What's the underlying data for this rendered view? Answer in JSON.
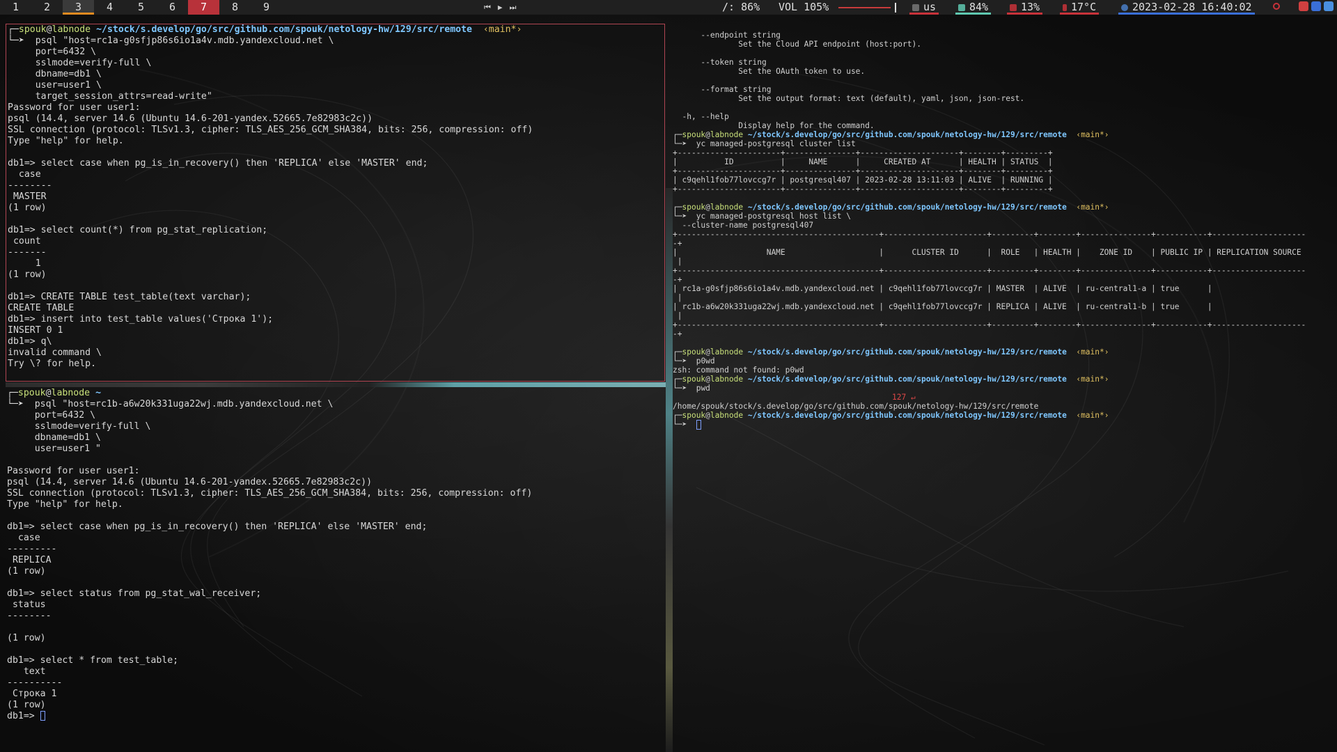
{
  "workspaces": [
    {
      "label": "1"
    },
    {
      "label": "2"
    },
    {
      "label": "3",
      "state": "focused"
    },
    {
      "label": "4"
    },
    {
      "label": "5"
    },
    {
      "label": "6"
    },
    {
      "label": "7",
      "state": "urgent"
    },
    {
      "label": "8"
    },
    {
      "label": "9"
    }
  ],
  "media": {
    "prev": "⏮",
    "play": "▶",
    "next": "⏭"
  },
  "status": {
    "disk": "/: 86%",
    "volume": "VOL 105%",
    "keyboard": "us",
    "battery": "84%",
    "cpu": "13%",
    "temperature": "17°C",
    "datetime": "2023-02-28 16:40:02"
  },
  "colors": {
    "accent_focus": "#e08a20",
    "urgent": "#b8323a",
    "path": "#7fc7ff",
    "host": "#c8e07a",
    "branch": "#e0c060",
    "error": "#e04848"
  },
  "prompt": {
    "user": "spouk",
    "at": "@",
    "host": "labnode",
    "path_remote": "~/stock/s.develop/go/src/github.com/spouk/netology-hw/129/src/remote",
    "path_home": "~",
    "branch": "‹main*›",
    "arrow": "└─➤"
  },
  "term1": {
    "cmd": "psql \"host=rc1a-g0sfjp86s6io1a4v.mdb.yandexcloud.net \\",
    "lines": [
      "     port=6432 \\",
      "     sslmode=verify-full \\",
      "     dbname=db1 \\",
      "     user=user1 \\",
      "     target_session_attrs=read-write\"",
      "Password for user user1:",
      "psql (14.4, server 14.6 (Ubuntu 14.6-201-yandex.52665.7e82983c2c))",
      "SSL connection (protocol: TLSv1.3, cipher: TLS_AES_256_GCM_SHA384, bits: 256, compression: off)",
      "Type \"help\" for help.",
      "",
      "db1=> select case when pg_is_in_recovery() then 'REPLICA' else 'MASTER' end;",
      "  case",
      "--------",
      " MASTER",
      "(1 row)",
      "",
      "db1=> select count(*) from pg_stat_replication;",
      " count",
      "-------",
      "     1",
      "(1 row)",
      "",
      "db1=> CREATE TABLE test_table(text varchar);",
      "CREATE TABLE",
      "db1=> insert into test_table values('Строка 1');",
      "INSERT 0 1",
      "db1=> q\\",
      "invalid command \\",
      "Try \\? for help."
    ]
  },
  "term2": {
    "cmd": "psql \"host=rc1b-a6w20k331uga22wj.mdb.yandexcloud.net \\",
    "lines": [
      "     port=6432 \\",
      "     sslmode=verify-full \\",
      "     dbname=db1 \\",
      "     user=user1 \"",
      "",
      "Password for user user1:",
      "psql (14.4, server 14.6 (Ubuntu 14.6-201-yandex.52665.7e82983c2c))",
      "SSL connection (protocol: TLSv1.3, cipher: TLS_AES_256_GCM_SHA384, bits: 256, compression: off)",
      "Type \"help\" for help.",
      "",
      "db1=> select case when pg_is_in_recovery() then 'REPLICA' else 'MASTER' end;",
      "  case",
      "---------",
      " REPLICA",
      "(1 row)",
      "",
      "db1=> select status from pg_stat_wal_receiver;",
      " status",
      "--------",
      "",
      "(1 row)",
      "",
      "db1=> select * from test_table;",
      "   text",
      "----------",
      " Строка 1",
      "(1 row)",
      ""
    ],
    "final_prompt": "db1=> "
  },
  "term3": {
    "help_lines": [
      "      --endpoint string",
      "              Set the Cloud API endpoint (host:port).",
      "",
      "      --token string",
      "              Set the OAuth token to use.",
      "",
      "      --format string",
      "              Set the output format: text (default), yaml, json, json-rest.",
      "",
      "  -h, --help",
      "              Display help for the command."
    ],
    "cmd1": "yc managed-postgresql cluster list",
    "cluster_table": [
      "+----------------------+---------------+---------------------+--------+---------+",
      "|          ID          |     NAME      |     CREATED AT      | HEALTH | STATUS  |",
      "+----------------------+---------------+---------------------+--------+---------+",
      "| c9qehl1fob77lovccg7r | postgresql407 | 2023-02-28 13:11:03 | ALIVE  | RUNNING |",
      "+----------------------+---------------+---------------------+--------+---------+"
    ],
    "cmd2": "yc managed-postgresql host list \\",
    "cmd2b": "  --cluster-name postgresql407",
    "host_table": [
      "+-------------------------------------------+----------------------+---------+--------+---------------+-----------+--------------------",
      "-+",
      "|                   NAME                    |      CLUSTER ID      |  ROLE   | HEALTH |    ZONE ID    | PUBLIC IP | REPLICATION SOURCE",
      " |",
      "+-------------------------------------------+----------------------+---------+--------+---------------+-----------+--------------------",
      "-+",
      "| rc1a-g0sfjp86s6io1a4v.mdb.yandexcloud.net | c9qehl1fob77lovccg7r | MASTER  | ALIVE  | ru-central1-a | true      |",
      " |",
      "| rc1b-a6w20k331uga22wj.mdb.yandexcloud.net | c9qehl1fob77lovccg7r | REPLICA | ALIVE  | ru-central1-b | true      |",
      " |",
      "+-------------------------------------------+----------------------+---------+--------+---------------+-----------+--------------------",
      "-+"
    ],
    "cmd3": "p0wd",
    "cmd3_out": "zsh: command not found: p0wd",
    "cmd4": "pwd",
    "exit_code": "127 ↵",
    "cmd4_out": "/home/spouk/stock/s.develop/go/src/github.com/spouk/netology-hw/129/src/remote"
  }
}
